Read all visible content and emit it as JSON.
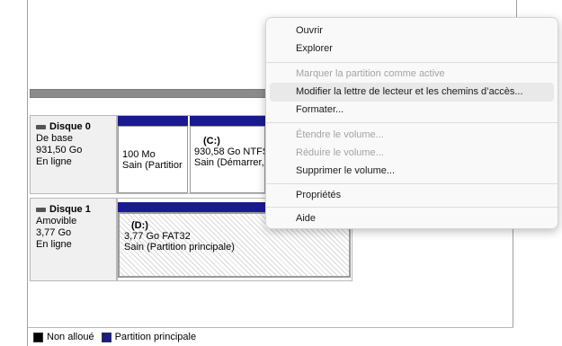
{
  "disks": [
    {
      "title": "Disque 0",
      "type": "De base",
      "size": "931,50 Go",
      "status": "En ligne",
      "partitions": [
        {
          "name": "",
          "size": "100 Mo",
          "status": "Sain (Partitior"
        },
        {
          "name": "(C:)",
          "size": "930,58 Go NTFS",
          "status": "Sain (Démarrer,"
        }
      ]
    },
    {
      "title": "Disque 1",
      "type": "Amovible",
      "size": "3,77 Go",
      "status": "En ligne",
      "partitions": [
        {
          "name": "(D:)",
          "size": "3,77 Go FAT32",
          "status": "Sain (Partition principale)"
        }
      ]
    }
  ],
  "legend": {
    "unallocated": "Non alloué",
    "primary": "Partition principale",
    "colors": {
      "unallocated": "#000000",
      "primary": "#1a1a8f"
    }
  },
  "context_menu": {
    "items": [
      {
        "label": "Ouvrir",
        "enabled": true
      },
      {
        "label": "Explorer",
        "enabled": true
      },
      {
        "label": "Marquer la partition comme active",
        "enabled": false
      },
      {
        "label": "Modifier la lettre de lecteur et les chemins d’accès...",
        "enabled": true,
        "highlighted": true
      },
      {
        "label": "Formater...",
        "enabled": true
      },
      {
        "label": "Étendre le volume...",
        "enabled": false
      },
      {
        "label": "Réduire le volume...",
        "enabled": false
      },
      {
        "label": "Supprimer le volume...",
        "enabled": true
      },
      {
        "label": "Propriétés",
        "enabled": true
      },
      {
        "label": "Aide",
        "enabled": true
      }
    ]
  }
}
